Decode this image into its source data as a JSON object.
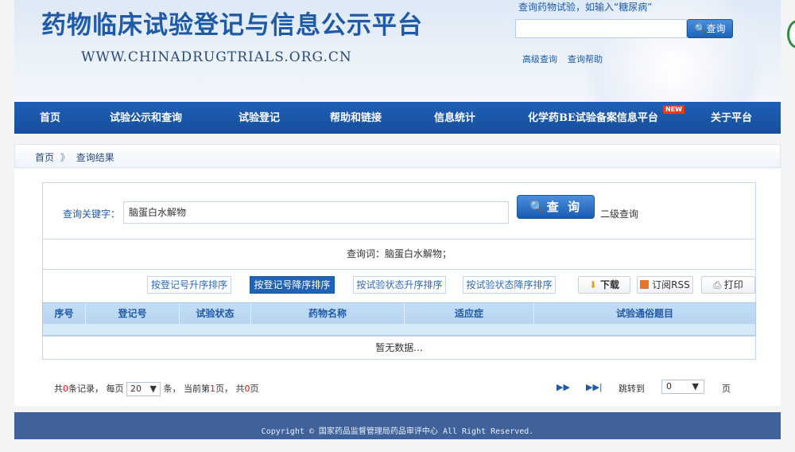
{
  "header": {
    "title": "药物临床试验登记与信息公示平台",
    "url": "WWW.CHINADRUGTRIALS.ORG.CN",
    "search_hint": "查询药物试验，如输入“糖尿病”",
    "search_button": "查询",
    "advanced_search": "高级查询",
    "search_help": "查询帮助"
  },
  "nav": {
    "items": [
      "首页",
      "试验公示和查询",
      "试验登记",
      "帮助和链接",
      "信息统计",
      "化学药BE试验备案信息平台",
      "关于平台"
    ],
    "new_badge": "NEW"
  },
  "breadcrumb": {
    "home": "首页",
    "separator": "》",
    "current": "查询结果"
  },
  "search": {
    "keyword_label": "查询关键字：",
    "keyword_value": "脑蛋白水解物",
    "button_label": "查 询",
    "secondary_label": "二级查询",
    "summary": "查询词：脑蛋白水解物；"
  },
  "sort_buttons": [
    "按登记号升序排序",
    "按登记号降序排序",
    "按试验状态升序排序",
    "按试验状态降序排序"
  ],
  "tools": {
    "download": "下载",
    "rss": "订阅RSS",
    "print": "打印"
  },
  "table": {
    "headers": [
      "序号",
      "登记号",
      "试验状态",
      "药物名称",
      "适应症",
      "试验通俗题目"
    ],
    "empty_message": "暂无数据..."
  },
  "pager": {
    "total_prefix": "共",
    "total_count": "0",
    "total_suffix": "条记录，  每页",
    "page_size": "20",
    "per_page_suffix": "条，  当前第",
    "current_page": "1",
    "current_suffix": "页，  共",
    "page_count": "0",
    "page_suffix": "页",
    "jump_label": "跳转到",
    "jump_value": "0",
    "page_word": "页"
  },
  "footer": {
    "copyright": "Copyright © 国家药品监督管理局药品审评中心 All Right Reserved."
  },
  "colors": {
    "brand_blue": "#1f5aa6",
    "nav_blue": "#1e5fb6",
    "footer_blue": "#3f629a"
  }
}
